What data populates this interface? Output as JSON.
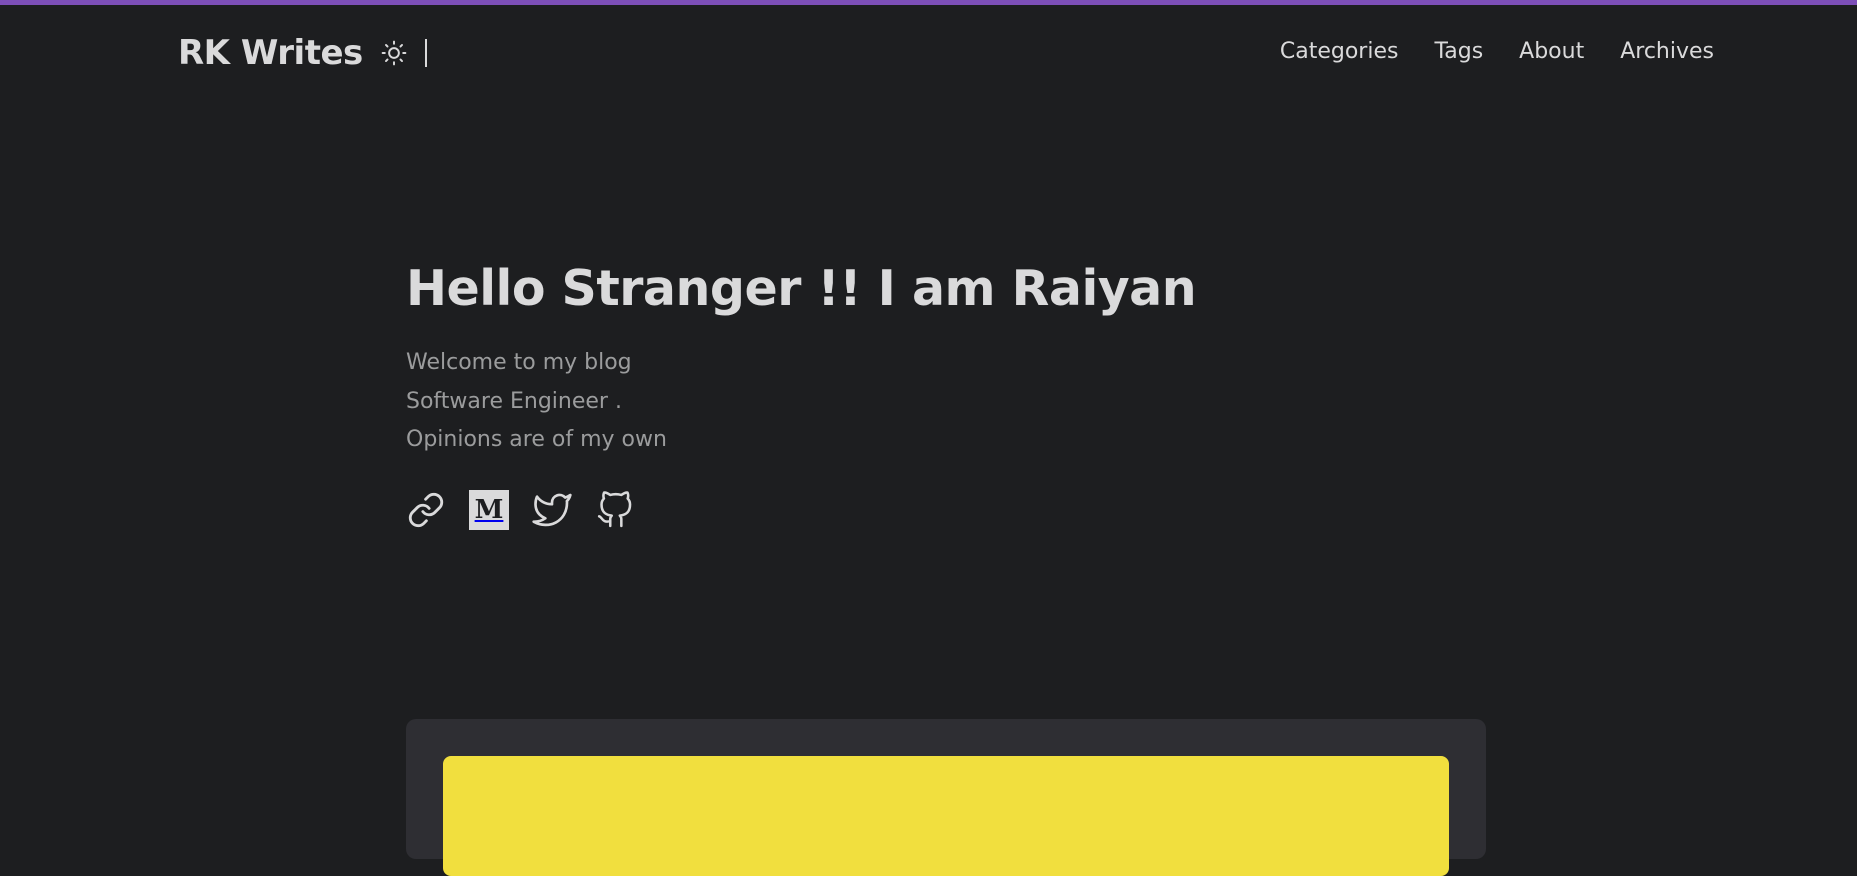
{
  "header": {
    "logo": "RK Writes",
    "theme_icon": "sun-icon",
    "nav": [
      {
        "label": "Categories"
      },
      {
        "label": "Tags"
      },
      {
        "label": "About"
      },
      {
        "label": "Archives"
      }
    ]
  },
  "hero": {
    "title": "Hello Stranger !! I am Raiyan",
    "lines": [
      "Welcome to my blog",
      "Software Engineer .",
      "Opinions are of my own"
    ],
    "socials": [
      {
        "icon": "link-icon"
      },
      {
        "icon": "medium-icon",
        "glyph": "M"
      },
      {
        "icon": "twitter-icon"
      },
      {
        "icon": "github-icon"
      }
    ]
  },
  "colors": {
    "background": "#1d1e20",
    "accent_bar": "#7d4fb8",
    "card": "#2e2e33",
    "cover": "#f1df3e",
    "primary_text": "#dadadb",
    "secondary_text": "#9b9c9d"
  }
}
